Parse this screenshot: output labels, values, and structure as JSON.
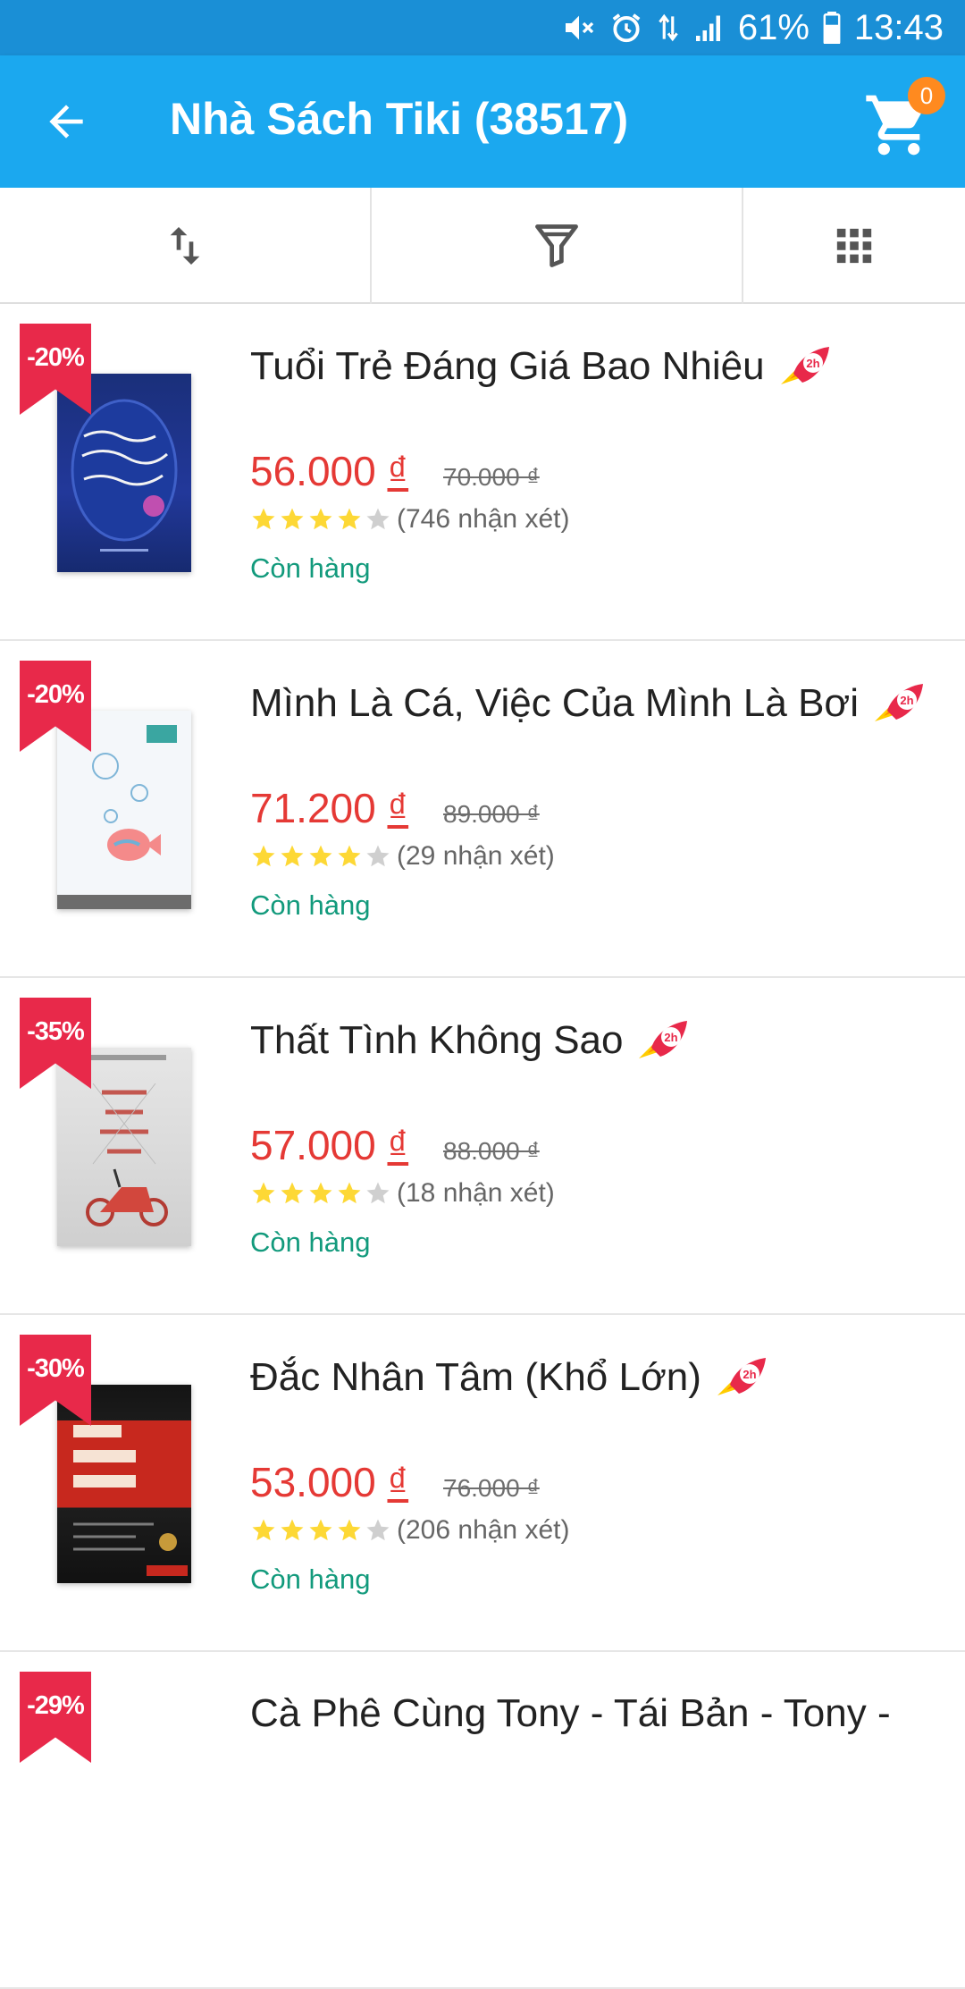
{
  "status_bar": {
    "battery": "61%",
    "time": "13:43"
  },
  "header": {
    "title": "Nhà Sách Tiki (38517)",
    "cart_count": "0",
    "back_icon": "arrow-left-icon",
    "cart_icon": "shopping-cart-icon"
  },
  "toolbar": {
    "sort_icon": "sort-arrows-icon",
    "filter_icon": "funnel-icon",
    "grid_icon": "grid-view-icon"
  },
  "products": [
    {
      "discount": "-20%",
      "title": "Tuổi Trẻ Đáng Giá Bao Nhiêu",
      "price": "56.000",
      "currency": "₫",
      "old_price": "70.000 ₫",
      "rating": 4,
      "reviews": "(746 nhận xét)",
      "stock": "Còn hàng"
    },
    {
      "discount": "-20%",
      "title": "Mình Là Cá, Việc Của Mình Là Bơi",
      "price": "71.200",
      "currency": "₫",
      "old_price": "89.000 ₫",
      "rating": 4,
      "reviews": "(29 nhận xét)",
      "stock": "Còn hàng"
    },
    {
      "discount": "-35%",
      "title": "Thất Tình Không Sao",
      "price": "57.000",
      "currency": "₫",
      "old_price": "88.000 ₫",
      "rating": 4,
      "reviews": "(18 nhận xét)",
      "stock": "Còn hàng"
    },
    {
      "discount": "-30%",
      "title": "Đắc Nhân Tâm (Khổ Lớn)",
      "price": "53.000",
      "currency": "₫",
      "old_price": "76.000 ₫",
      "rating": 4,
      "reviews": "(206 nhận xét)",
      "stock": "Còn hàng"
    },
    {
      "discount": "-29%",
      "title": "Cà Phê Cùng Tony - Tái Bản - Tony -",
      "price": "",
      "currency": "",
      "old_price": "",
      "rating": 0,
      "reviews": "",
      "stock": ""
    }
  ],
  "colors": {
    "status_bar": "#1a8fd6",
    "app_bar": "#1ba8ef",
    "discount_ribbon": "#e8294a",
    "price": "#e53935",
    "in_stock": "#129a7c",
    "cart_badge": "#ff8a1f",
    "star_filled": "#fdd835",
    "star_empty": "#cfcfcf"
  }
}
